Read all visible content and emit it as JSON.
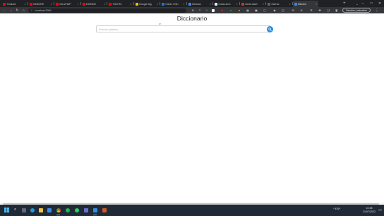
{
  "browser": {
    "tabs": [
      {
        "label": "Youtube",
        "color": "#ff0000",
        "active": false
      },
      {
        "label": "SANGRE",
        "color": "#ff0000",
        "active": false
      },
      {
        "label": "Dia ZHAP",
        "color": "#ff0000",
        "active": false
      },
      {
        "label": "DIONDE",
        "color": "#ff0000",
        "active": false
      },
      {
        "label": "TUN Re",
        "color": "#ff0000",
        "active": false
      },
      {
        "label": "Google tag",
        "color": "#fbbc04",
        "active": false
      },
      {
        "label": "Hacer Chin",
        "color": "#1a73e8",
        "active": false
      },
      {
        "label": "Introduc",
        "color": "#4285f4",
        "active": false
      },
      {
        "label": "reads amo",
        "color": "#e8eaed",
        "active": false
      },
      {
        "label": "ms/ts-dash",
        "color": "#d93025",
        "active": false
      },
      {
        "label": "Interac",
        "color": "#5f6368",
        "active": false
      },
      {
        "label": "Diccion",
        "color": "#2d8ce0",
        "active": true
      }
    ],
    "new_tab_symbol": "+",
    "url": "localhost:3000",
    "profile_label": "Reiniciar y actualizar",
    "window_controls": [
      "–",
      "□",
      "✕"
    ]
  },
  "page": {
    "title": "Diccionario",
    "search": {
      "placeholder": "Buscar palabra...",
      "value": ""
    }
  },
  "taskbar": {
    "tray_text": "^  ESP",
    "time": "10:38",
    "date": "21/07/2022",
    "apps": [
      "windows",
      "search",
      "task-view",
      "edge",
      "file-explorer",
      "store",
      "chrome",
      "spotify",
      "whatsapp",
      "vscode",
      "terminal",
      "app"
    ]
  },
  "colors": {
    "accent": "#2d8ce0",
    "tabbar": "#202124",
    "toolbar": "#35363a",
    "taskbar": "#1f2a36"
  }
}
